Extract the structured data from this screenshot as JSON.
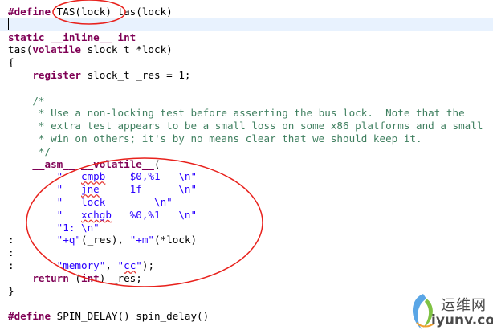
{
  "editor": {
    "lines": [
      {
        "t": [
          {
            "c": "kw",
            "v": "#define"
          },
          {
            "v": " TAS(lock) tas(lock)"
          }
        ]
      },
      {
        "t": []
      },
      {
        "t": [
          {
            "c": "kw",
            "v": "static"
          },
          {
            "v": " "
          },
          {
            "c": "kw",
            "v": "__inline__"
          },
          {
            "v": " "
          },
          {
            "c": "kw",
            "v": "int"
          }
        ]
      },
      {
        "t": [
          {
            "v": "tas("
          },
          {
            "c": "kw",
            "v": "volatile"
          },
          {
            "v": " slock_t *lock)"
          }
        ]
      },
      {
        "t": [
          {
            "v": "{"
          }
        ]
      },
      {
        "t": [
          {
            "v": "    "
          },
          {
            "c": "kw",
            "v": "register"
          },
          {
            "v": " slock_t _res = 1;"
          }
        ]
      },
      {
        "t": []
      },
      {
        "t": [
          {
            "c": "cm",
            "v": "    /*"
          }
        ]
      },
      {
        "t": [
          {
            "c": "cm",
            "v": "     * Use a non-locking test before asserting the bus lock.  Note that the"
          }
        ]
      },
      {
        "t": [
          {
            "c": "cm",
            "v": "     * extra test appears to be a small loss on some x86 platforms and a small"
          }
        ]
      },
      {
        "t": [
          {
            "c": "cm",
            "v": "     * win on others; it's by no means clear that we should keep it."
          }
        ]
      },
      {
        "t": [
          {
            "c": "cm",
            "v": "     */"
          }
        ]
      },
      {
        "t": [
          {
            "v": "    "
          },
          {
            "c": "kw",
            "v": "__asm__"
          },
          {
            "v": " "
          },
          {
            "c": "kw",
            "v": "__volatile__"
          },
          {
            "v": "("
          }
        ]
      },
      {
        "t": [
          {
            "v": "        "
          },
          {
            "c": "str",
            "v": "\"   "
          },
          {
            "c": "str sq",
            "v": "cmpb"
          },
          {
            "c": "str",
            "v": "    $0,%1   \\n\""
          }
        ]
      },
      {
        "t": [
          {
            "v": "        "
          },
          {
            "c": "str",
            "v": "\"   "
          },
          {
            "c": "str sq",
            "v": "jne"
          },
          {
            "c": "str",
            "v": "     1f      \\n\""
          }
        ]
      },
      {
        "t": [
          {
            "v": "        "
          },
          {
            "c": "str",
            "v": "\"   lock        \\n\""
          }
        ]
      },
      {
        "t": [
          {
            "v": "        "
          },
          {
            "c": "str",
            "v": "\"   "
          },
          {
            "c": "str sq",
            "v": "xchgb"
          },
          {
            "c": "str",
            "v": "   %0,%1   \\n\""
          }
        ]
      },
      {
        "t": [
          {
            "v": "        "
          },
          {
            "c": "str",
            "v": "\"1: \\n\""
          }
        ]
      },
      {
        "t": [
          {
            "v": ":       "
          },
          {
            "c": "str",
            "v": "\"+q\""
          },
          {
            "v": "(_res), "
          },
          {
            "c": "str",
            "v": "\"+m\""
          },
          {
            "v": "(*lock)"
          }
        ]
      },
      {
        "t": [
          {
            "v": ":"
          }
        ]
      },
      {
        "t": [
          {
            "v": ":       "
          },
          {
            "c": "str",
            "v": "\"memory\""
          },
          {
            "v": ", "
          },
          {
            "c": "str",
            "v": "\""
          },
          {
            "c": "str sq",
            "v": "cc"
          },
          {
            "c": "str",
            "v": "\""
          },
          {
            "v": ");"
          }
        ]
      },
      {
        "t": [
          {
            "v": "    "
          },
          {
            "c": "kw",
            "v": "return"
          },
          {
            "v": " ("
          },
          {
            "c": "kw",
            "v": "int"
          },
          {
            "v": ") _res;"
          }
        ]
      },
      {
        "t": [
          {
            "v": "}"
          }
        ]
      },
      {
        "t": []
      },
      {
        "t": [
          {
            "c": "kw",
            "v": "#define"
          },
          {
            "v": " SPIN_DELAY() spin_delay()"
          }
        ]
      }
    ]
  },
  "annotations": {
    "ellipse_color": "#e8211c"
  },
  "watermark": {
    "name_cn": "运维网",
    "url": "iyunv.com"
  }
}
